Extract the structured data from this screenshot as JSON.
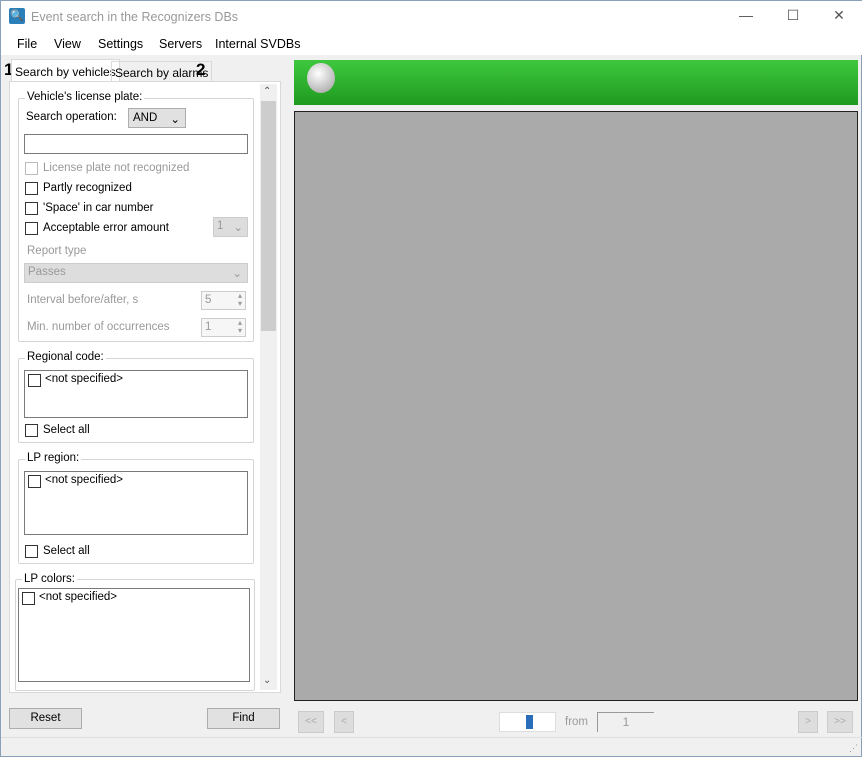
{
  "window": {
    "title": "Event search in the Recognizers DBs",
    "minimize": "—",
    "maximize": "☐",
    "close": "✕"
  },
  "menu": [
    "File",
    "View",
    "Settings",
    "Servers",
    "Internal SVDBs"
  ],
  "tabs": [
    {
      "label": "Search by vehicles",
      "marker": "1"
    },
    {
      "label": "Search by alarms",
      "marker": "2"
    }
  ],
  "plate": {
    "group": "Vehicle's license plate:",
    "search_op_label": "Search operation:",
    "search_op_value": "AND",
    "plate_value": "",
    "not_recognized": "License plate not recognized",
    "partly": "Partly recognized",
    "space": "'Space' in car number",
    "error_amount": "Acceptable error amount",
    "error_value": "1",
    "report_type_label": "Report type",
    "report_type_value": "Passes",
    "interval_label": "Interval before/after, s",
    "interval_value": "5",
    "min_occ_label": "Min. number of occurrences",
    "min_occ_value": "1"
  },
  "regional": {
    "group": "Regional code:",
    "item": "<not specified>",
    "select_all": "Select all"
  },
  "lp_region": {
    "group": "LP region:",
    "item": "<not specified>",
    "select_all": "Select all"
  },
  "lp_colors": {
    "group": "LP colors:",
    "item": "<not specified>"
  },
  "buttons": {
    "reset": "Reset",
    "find": "Find"
  },
  "pager": {
    "first": "<<",
    "prev": "<",
    "from": "from",
    "total": "1",
    "next": ">",
    "last": ">>"
  },
  "colors": {
    "banner": "#2fb62f"
  }
}
